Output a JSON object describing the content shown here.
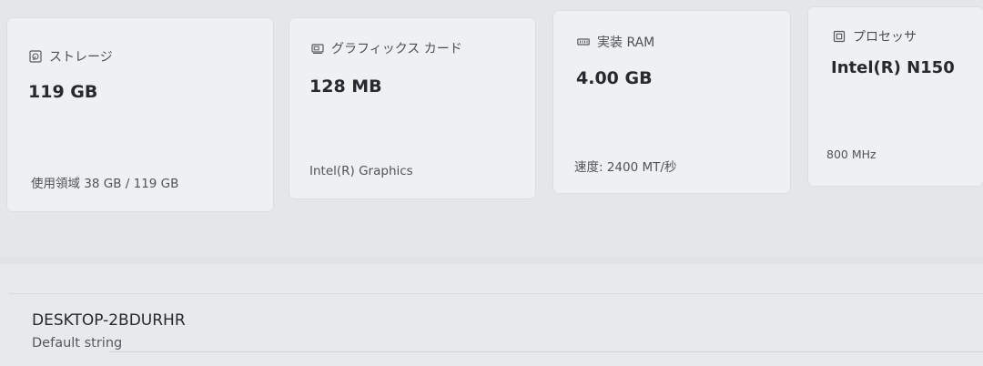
{
  "cards": {
    "storage": {
      "label": "ストレージ",
      "value": "119 GB",
      "detail": "使用領域 38 GB / 119 GB",
      "icon": "storage-icon"
    },
    "graphics": {
      "label": "グラフィックス カード",
      "value": "128 MB",
      "detail": "Intel(R) Graphics",
      "icon": "graphics-card-icon"
    },
    "ram": {
      "label": "実装 RAM",
      "value": "4.00 GB",
      "detail": "速度: 2400 MT/秒",
      "icon": "memory-icon"
    },
    "processor": {
      "label": "プロセッサ",
      "value": "Intel(R) N150",
      "detail": "800 MHz",
      "icon": "processor-icon"
    }
  },
  "device": {
    "name": "DESKTOP-2BDURHR",
    "model": "Default string"
  }
}
